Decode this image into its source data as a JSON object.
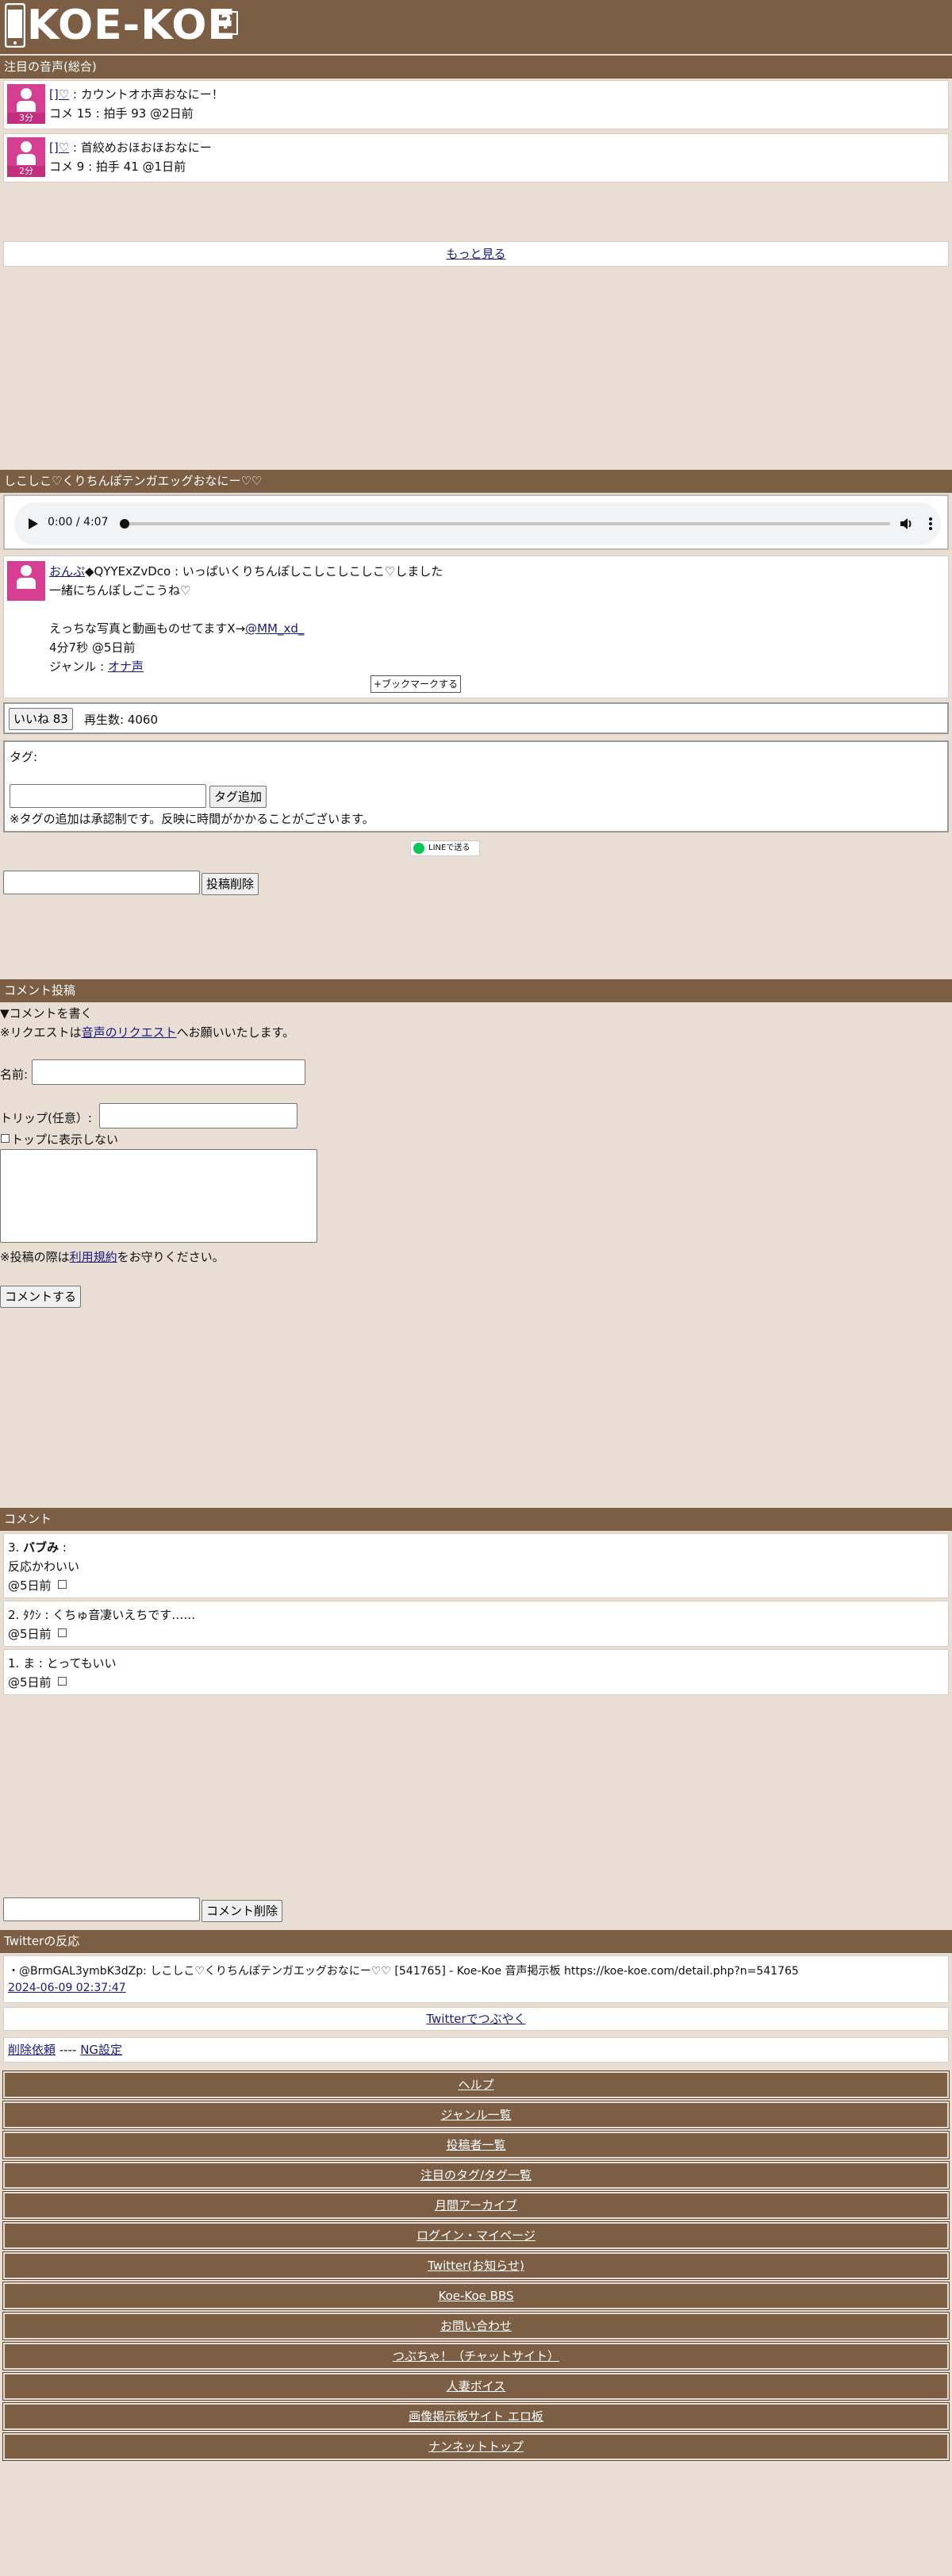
{
  "brand": {
    "title": "KOE-KOE",
    "help": "?"
  },
  "popular": {
    "header": "注目の音声(総合)",
    "items": [
      {
        "duration": "3分",
        "user": "[]♡",
        "title": " : カウントオホ声おなにー！",
        "meta": "コメ 15 : 拍手 93 @2日前"
      },
      {
        "duration": "2分",
        "user": "[]♡",
        "title": " : 首絞めおほおほおなにー",
        "meta": "コメ 9 : 拍手 41 @1日前"
      }
    ],
    "more": "もっと見る"
  },
  "post": {
    "header": "しこしこ♡くりちんぽテンガエッグおなにー♡♡",
    "audio_time": "0:00 / 4:07",
    "poster_name": "おんぷ",
    "poster_trip": "◆QYYExZvDco",
    "desc1": " : いっぱいくりちんぽしこしこしこしこ♡しました",
    "desc2": "一緒にちんぽしごこうね♡",
    "desc3": "えっちな写真と動画ものせてますX→",
    "x_link": "@MM_xd_",
    "length": "4分7秒 @5日前",
    "genre_label": "ジャンル : ",
    "genre": "オナ声",
    "bookmark": "+ブックマークする",
    "like": "いいね 83",
    "plays": "再生数: 4060",
    "tag_label": "タグ:",
    "tag_add": "タグ追加",
    "tag_note": "※タグの追加は承認制です。反映に時間がかかることがございます。",
    "line_share": "LINEで送る",
    "delete_button": "投稿削除"
  },
  "comment_form": {
    "header": "コメント投稿",
    "toggle": "▼コメントを書く",
    "request_pre": "※リクエストは",
    "request_link": "音声のリクエスト",
    "request_post": "へお願いいたします。",
    "name_label": "名前:",
    "trip_label": "トリップ(任意）:",
    "hide_top": "トップに表示しない",
    "rules_pre": "※投稿の際は",
    "rules_link": "利用規約",
    "rules_post": "をお守りください。",
    "submit": "コメントする"
  },
  "comments": {
    "header": "コメント",
    "items": [
      {
        "num": "3.",
        "name": "バブみ",
        "sep": " :",
        "text": "反応かわいい",
        "time": "@5日前"
      },
      {
        "num": "2.",
        "name": "ﾀｸｼ",
        "sep": " : ",
        "text": "くちゅ音凄いえちです……",
        "time": "@5日前"
      },
      {
        "num": "1.",
        "name": "ま",
        "sep": " : ",
        "text": "とってもいい",
        "time": "@5日前"
      }
    ],
    "delete_button": "コメント削除"
  },
  "twitter": {
    "header": "Twitterの反応",
    "tweet": "・@BrmGAL3ymbK3dZp: しこしこ♡くりちんぽテンガエッグおなにー♡♡ [541765] - Koe-Koe 音声掲示板 https://koe-koe.com/detail.php?n=541765",
    "tweet_time": "2024-06-09 02:37:47",
    "tweet_button": "Twitterでつぶやく",
    "delete_request": "削除依頼",
    "sep": " ---- ",
    "ng": "NG設定"
  },
  "nav": [
    "ヘルプ",
    "ジャンル一覧",
    "投稿者一覧",
    "注目のタグ/タグ一覧",
    "月間アーカイブ",
    "ログイン・マイページ",
    "Twitter(お知らせ)",
    "Koe-Koe BBS",
    "お問い合わせ",
    "つぶちゃ！（チャットサイト）",
    "人妻ボイス",
    "画像掲示板サイト エロ板",
    "ナンネットトップ"
  ],
  "colors": {
    "header_bg": "#7b5e44",
    "page_bg": "#e8ded4",
    "avatar_pink": "#d63f91",
    "link": "#1a1a80"
  }
}
